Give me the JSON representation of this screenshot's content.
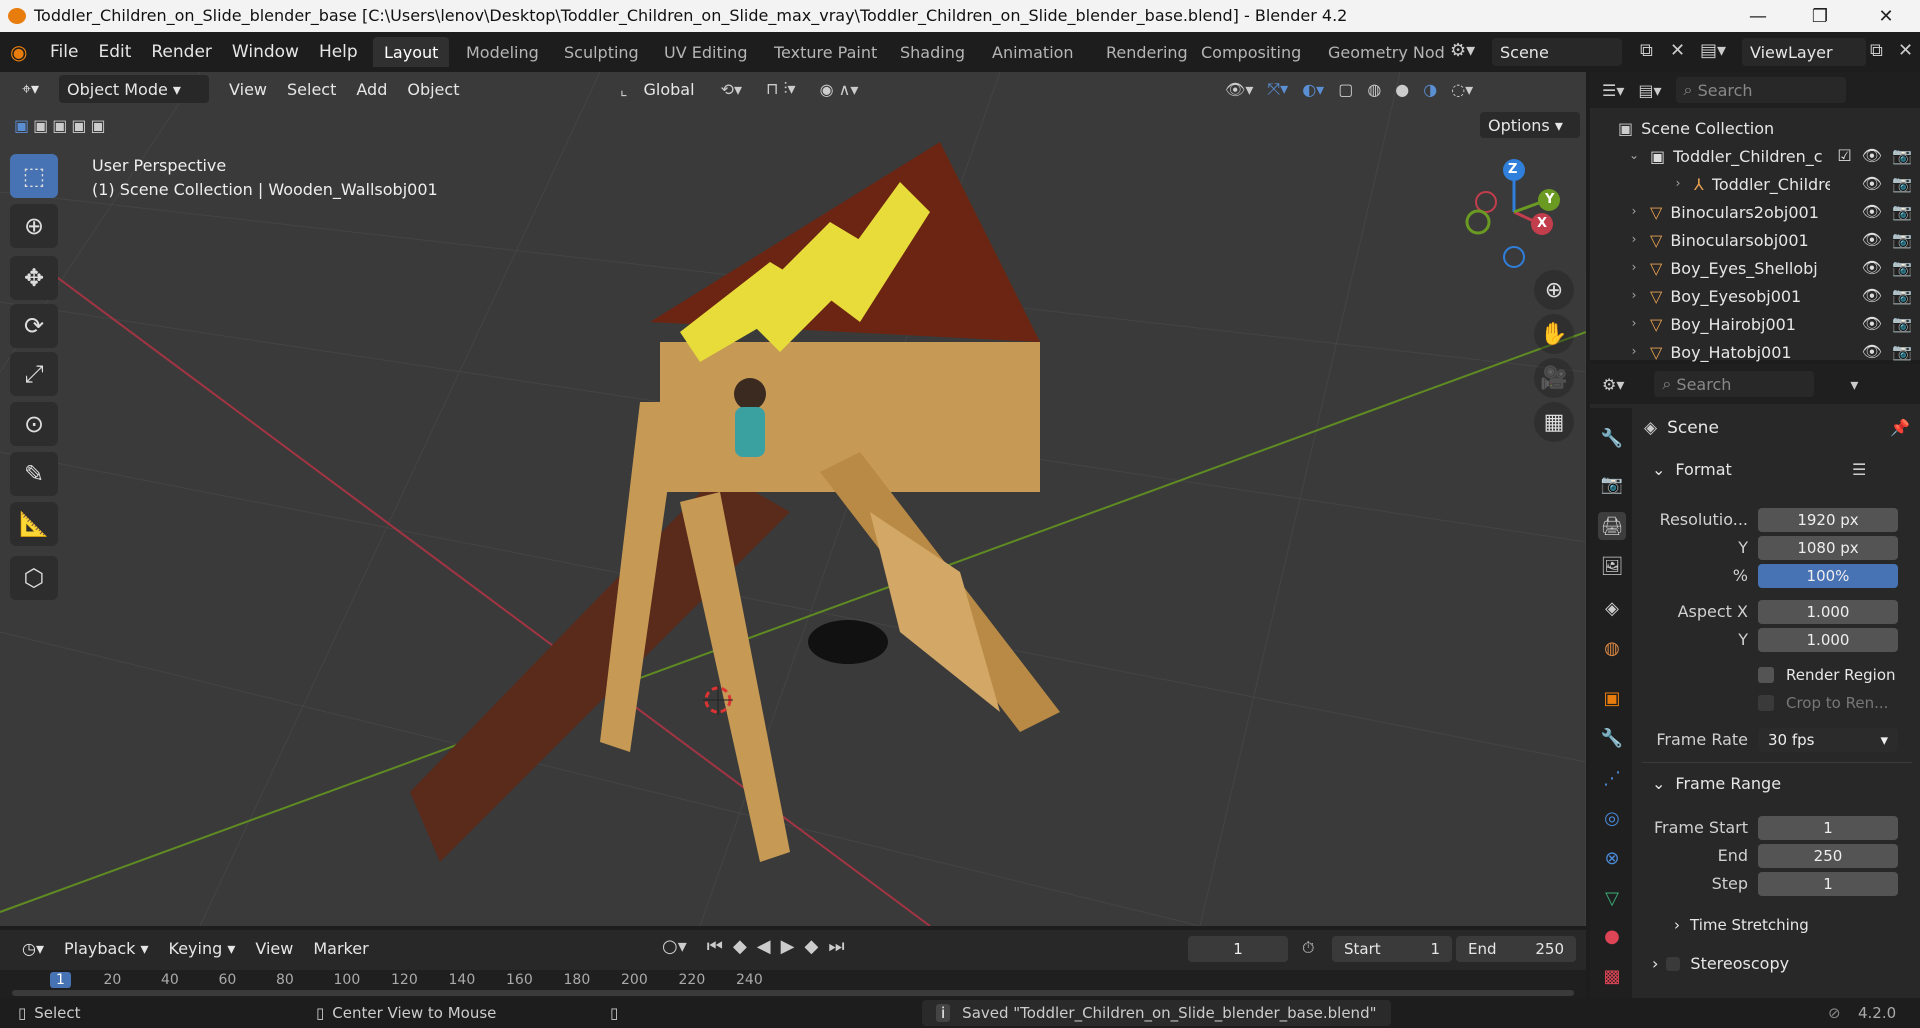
{
  "titlebar": {
    "title": "Toddler_Children_on_Slide_blender_base [C:\\Users\\lenov\\Desktop\\Toddler_Children_on_Slide_max_vray\\Toddler_Children_on_Slide_blender_base.blend] - Blender 4.2",
    "minimize": "—",
    "maximize": "❐",
    "close": "✕"
  },
  "menubar": {
    "items": [
      "File",
      "Edit",
      "Render",
      "Window",
      "Help"
    ],
    "workspaces": [
      "Layout",
      "Modeling",
      "Sculpting",
      "UV Editing",
      "Texture Paint",
      "Shading",
      "Animation",
      "Rendering",
      "Compositing",
      "Geometry Nod"
    ],
    "active_workspace": "Layout",
    "scene": "Scene",
    "view_layer": "ViewLayer"
  },
  "viewport_header": {
    "mode": "Object Mode",
    "menus": [
      "View",
      "Select",
      "Add",
      "Object"
    ],
    "transform_orientation": "Global",
    "options": "Options"
  },
  "viewport": {
    "perspective": "User Perspective",
    "collection_info": "(1) Scene Collection | Wooden_Wallsobj001",
    "gizmo_labels": {
      "z": "Z",
      "y": "Y",
      "x": "X"
    }
  },
  "outliner": {
    "search_placeholder": "Search",
    "root": "Scene Collection",
    "items": [
      {
        "label": "Toddler_Children_c",
        "level": 1,
        "icon": "collection-icon"
      },
      {
        "label": "Toddler_Childre",
        "level": 2,
        "icon": "armature-icon"
      },
      {
        "label": "Binoculars2obj001",
        "level": 1,
        "icon": "mesh-icon"
      },
      {
        "label": "Binocularsobj001",
        "level": 1,
        "icon": "mesh-icon"
      },
      {
        "label": "Boy_Eyes_Shellobj",
        "level": 1,
        "icon": "mesh-icon"
      },
      {
        "label": "Boy_Eyesobj001",
        "level": 1,
        "icon": "mesh-icon"
      },
      {
        "label": "Boy_Hairobj001",
        "level": 1,
        "icon": "mesh-icon"
      },
      {
        "label": "Boy_Hatobj001",
        "level": 1,
        "icon": "mesh-icon"
      }
    ]
  },
  "properties": {
    "search_placeholder": "Search",
    "context": "Scene",
    "format": {
      "title": "Format",
      "resolution_label": "Resolutio...",
      "res_x": "1920 px",
      "y_label": "Y",
      "res_y": "1080 px",
      "percent_label": "%",
      "percent": "100%",
      "aspect_x_label": "Aspect X",
      "aspect_x": "1.000",
      "aspect_y_label": "Y",
      "aspect_y": "1.000",
      "render_region": "Render Region",
      "crop": "Crop to Ren...",
      "frame_rate_label": "Frame Rate",
      "frame_rate": "30 fps"
    },
    "frame_range": {
      "title": "Frame Range",
      "start_label": "Frame Start",
      "start": "1",
      "end_label": "End",
      "end": "250",
      "step_label": "Step",
      "step": "1"
    },
    "time_stretching": "Time Stretching",
    "stereoscopy": "Stereoscopy"
  },
  "timeline": {
    "menus": [
      "Playback",
      "Keying",
      "View",
      "Marker"
    ],
    "current_frame": "1",
    "start_label": "Start",
    "start": "1",
    "end_label": "End",
    "end": "250",
    "ruler": [
      "1",
      "20",
      "40",
      "60",
      "80",
      "100",
      "120",
      "140",
      "160",
      "180",
      "200",
      "220",
      "240"
    ]
  },
  "statusbar": {
    "select": "Select",
    "center": "Center View to Mouse",
    "message": "Saved \"Toddler_Children_on_Slide_blender_base.blend\"",
    "version": "4.2.0"
  },
  "colors": {
    "accent": "#4772b3",
    "orange": "#e87d0d",
    "x_axis": "#c33e4d",
    "y_axis": "#6a9a22",
    "z_axis": "#2f7fdb"
  }
}
